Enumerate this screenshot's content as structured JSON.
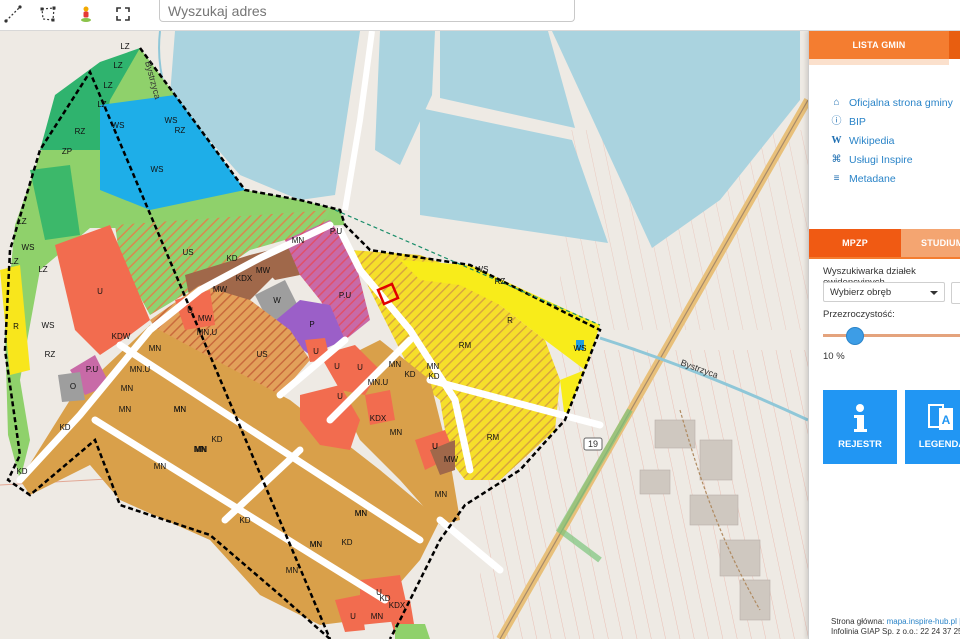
{
  "toolbar": {
    "tools": [
      "measure-line-icon",
      "measure-area-icon",
      "street-view-icon",
      "fullscreen-icon"
    ],
    "search": {
      "placeholder": "Wyszukaj adres"
    }
  },
  "map": {
    "zone_labels": [
      "LZ",
      "LZ",
      "LZ",
      "LZ",
      "WS",
      "RZ",
      "WS",
      "RZ",
      "WS",
      "ZP",
      "LZ",
      "WS",
      "LZ",
      "LZ",
      "US",
      "P.U",
      "MN",
      "KD",
      "MW",
      "KDX",
      "MW",
      "U",
      "W",
      "P.U",
      "MW",
      "U",
      "P",
      "U",
      "MN.U",
      "WS",
      "RZ",
      "R",
      "RM",
      "WS",
      "R",
      "WS",
      "RZ",
      "KDW",
      "MN",
      "MN.U",
      "MN",
      "US",
      "P.U",
      "O",
      "KD",
      "MN",
      "MN",
      "MN.U",
      "KD",
      "U",
      "U",
      "KDX",
      "U",
      "MN",
      "KD",
      "MN",
      "MN",
      "KD",
      "MN",
      "RM",
      "MN",
      "U",
      "MN",
      "MW",
      "MN",
      "KD",
      "KD",
      "MN",
      "MN",
      "KD",
      "MN",
      "MN",
      "KD",
      "KDX",
      "U",
      "U",
      "U",
      "MN",
      "MN",
      "MN",
      "MN"
    ],
    "road_labels": [
      "Bystrzyca",
      "Bystrzyca"
    ],
    "route_badge": "19",
    "colors": {
      "water": "#aad3df",
      "forest": "#3cb371",
      "agriculture": "#ffff00",
      "residential": "#d9a04a",
      "services": "#f26c4f",
      "plan_border": "#000000"
    }
  },
  "panel": {
    "tabs": [
      {
        "label": "LISTA GMIN"
      },
      {
        "label": "MPZP"
      },
      {
        "label": "STUDIUM"
      }
    ],
    "links": [
      {
        "icon": "home-icon",
        "label": "Oficjalna strona gminy"
      },
      {
        "icon": "info-icon",
        "label": "BIP"
      },
      {
        "icon": "wikipedia-icon",
        "label": "Wikipedia"
      },
      {
        "icon": "institution-icon",
        "label": "Usługi Inspire"
      },
      {
        "icon": "database-icon",
        "label": "Metadane"
      }
    ],
    "search_label": "Wyszukiwarka działek ewidencyjnych",
    "precinct_select": {
      "value": "Wybierz obręb"
    },
    "transparency_label": "Przezroczystość:",
    "transparency_value": "10 %",
    "transparency_level": 0.1,
    "buttons": [
      {
        "label": "REJESTR",
        "icon": "info-icon"
      },
      {
        "label": "LEGENDA",
        "icon": "legend-icon"
      }
    ],
    "footer": {
      "line1_prefix": "Strona główna: ",
      "line1_link": "mapa.inspire-hub.pl |",
      "line2": "Infolinia GIAP Sp. z o.o.: 22 24 37 25"
    },
    "accent": "#f47d30",
    "button_color": "#2196f3"
  }
}
